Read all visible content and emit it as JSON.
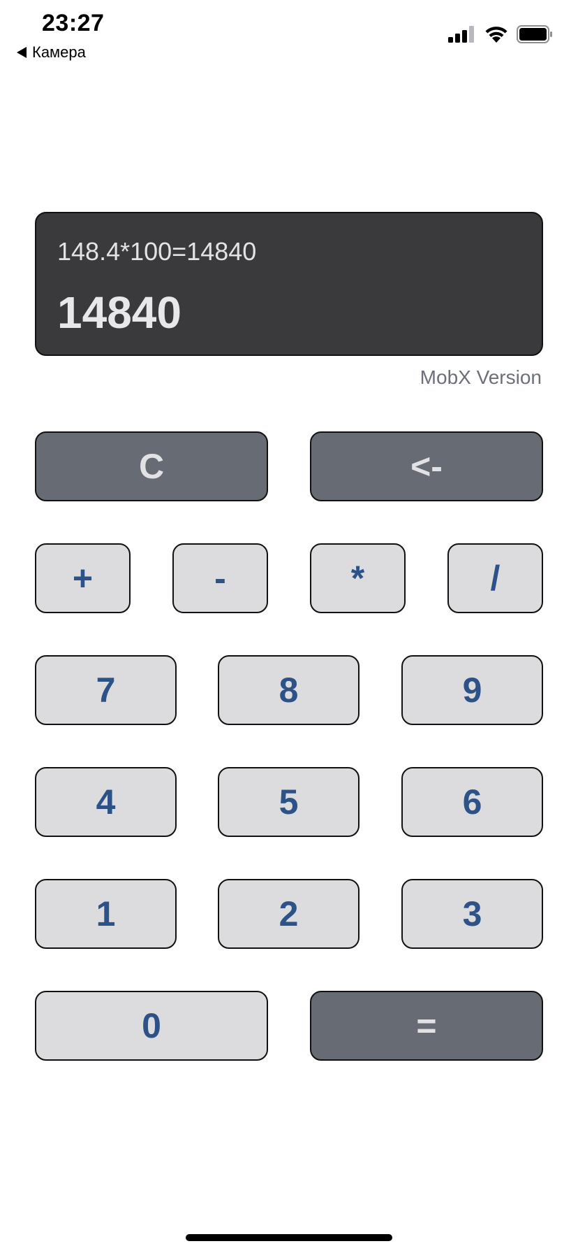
{
  "status_bar": {
    "time": "23:27",
    "back_label": "Камера",
    "icons": [
      "signal-icon",
      "wifi-icon",
      "battery-icon"
    ]
  },
  "display": {
    "expression": "148.4*100=14840",
    "result": "14840"
  },
  "version_label": "MobX Version",
  "keys": {
    "clear": "C",
    "backspace": "<-",
    "plus": "+",
    "minus": "-",
    "multiply": "*",
    "divide": "/",
    "seven": "7",
    "eight": "8",
    "nine": "9",
    "four": "4",
    "five": "5",
    "six": "6",
    "one": "1",
    "two": "2",
    "three": "3",
    "zero": "0",
    "equals": "="
  },
  "colors": {
    "display_bg": "#3a393c",
    "key_light": "#dcdcdf",
    "key_dark": "#666b74",
    "key_text": "#2c5287",
    "version_text": "#6c707a"
  }
}
